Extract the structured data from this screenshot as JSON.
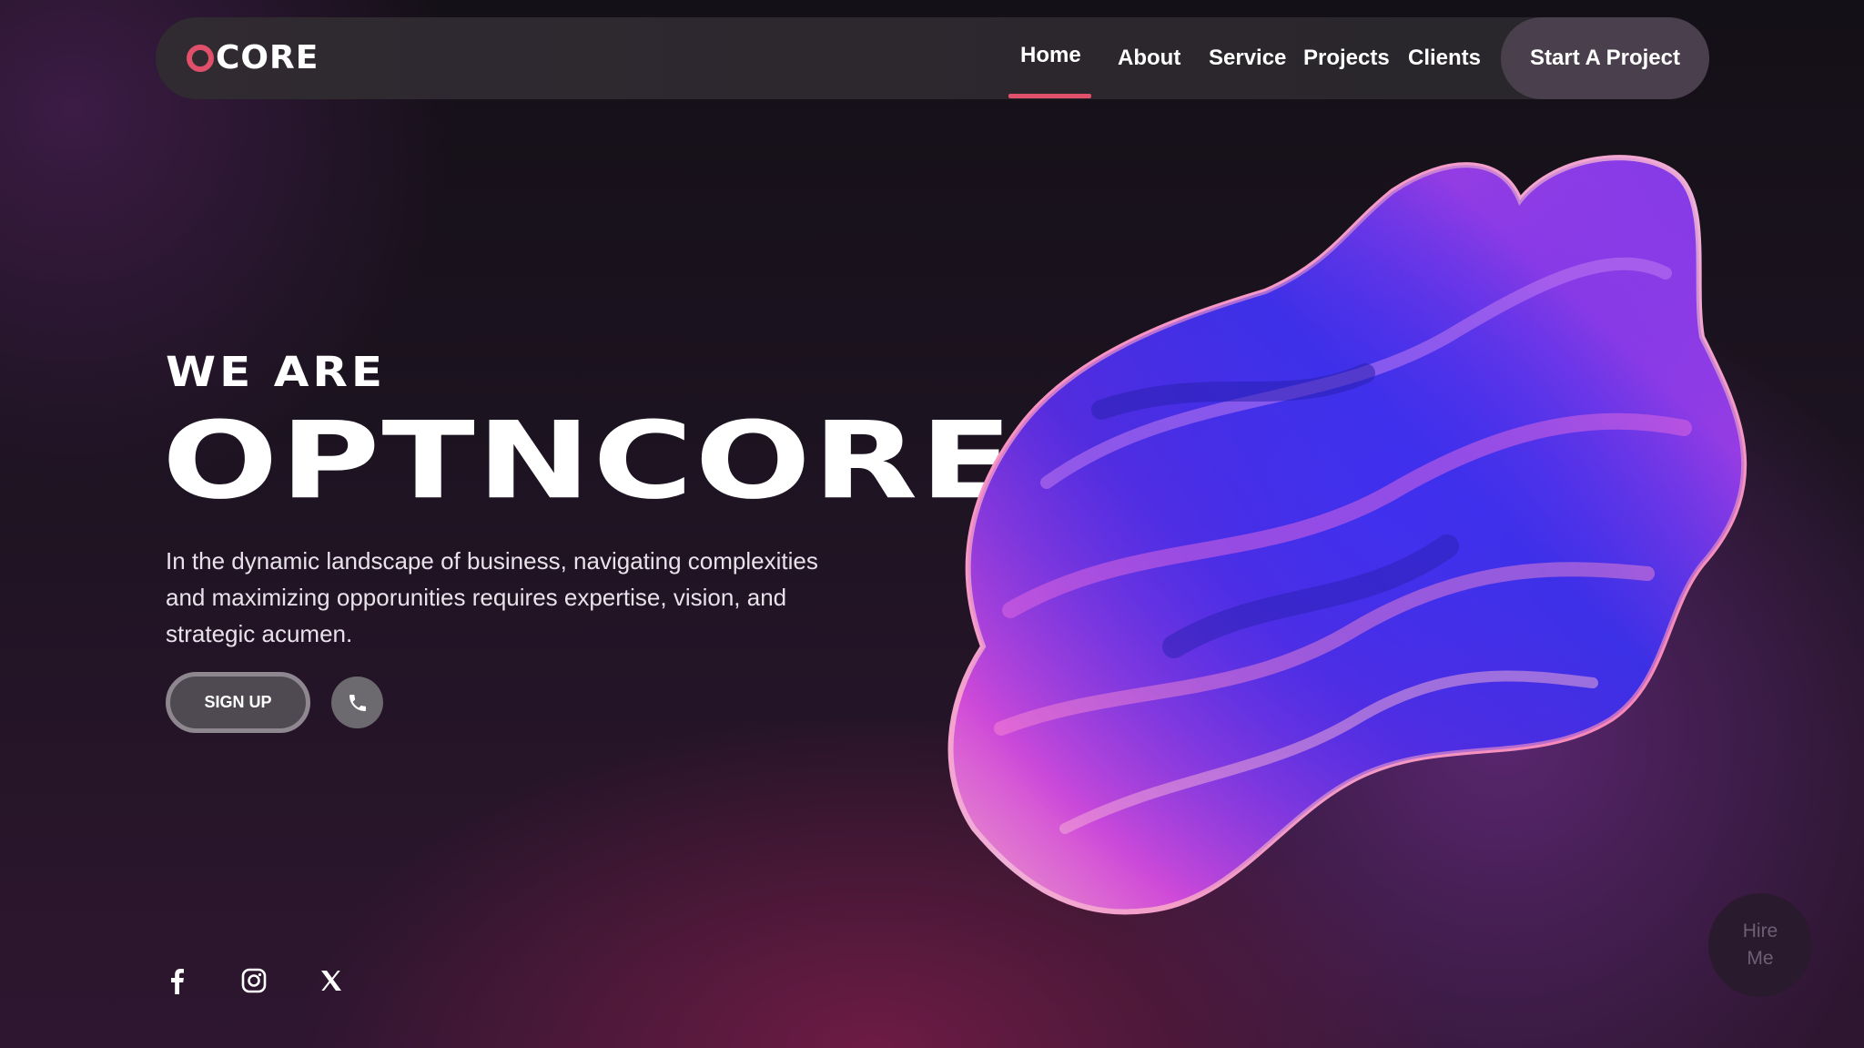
{
  "nav": {
    "logo_text": "CORE",
    "links": [
      "Home",
      "About",
      "Service",
      "Projects",
      "Clients"
    ],
    "active": "Home",
    "cta_label": "Start A Project"
  },
  "hero": {
    "eyebrow": "WE ARE",
    "title": "OPTNCORE",
    "description": "In the dynamic landscape of business, navigating complexities and maximizing opporunities requires expertise, vision, and strategic acumen.",
    "signup_label": "SIGN UP"
  },
  "social": {
    "icons": [
      "facebook-icon",
      "instagram-icon",
      "x-icon"
    ]
  },
  "hire_me": {
    "label": "Hire\nMe"
  },
  "colors": {
    "accent": "#e0506b",
    "nav_bg": "#2b272d",
    "cta_bg": "#4a3f4c"
  }
}
